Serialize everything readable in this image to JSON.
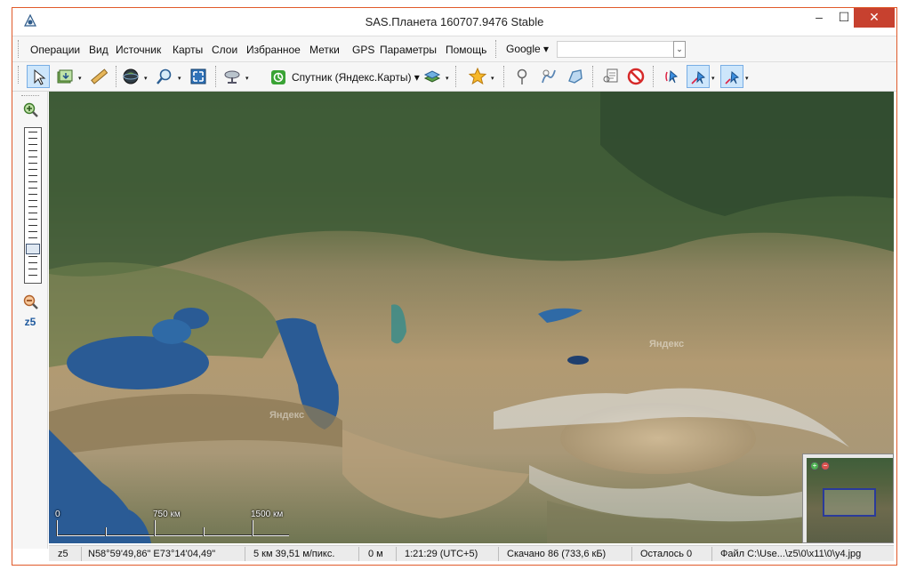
{
  "window": {
    "title": "SAS.Планета 160707.9476 Stable",
    "minimize_glyph": "–",
    "maximize_glyph": "☐",
    "close_glyph": "✕"
  },
  "menu": {
    "items": [
      "Операции",
      "Вид",
      "Источник",
      "Карты",
      "Слои",
      "Избранное",
      "Метки",
      "GPS",
      "Параметры",
      "Помощь"
    ],
    "search_provider": "Google ▾",
    "search_value": "",
    "dropdown_glyph": "⌄"
  },
  "toolbar": {
    "map_type_label": "Спутник (Яндекс.Карты) ▾",
    "arrow_glyph": "▾",
    "icons": [
      "cursor-icon",
      "tile-download-icon",
      "ruler-icon",
      "globe-icon",
      "magnifier-icon",
      "fullscreen-icon",
      "satellite-dish-icon",
      "map-source-icon",
      "layers-icon",
      "favorites-star-icon",
      "placemark-icon",
      "path-icon",
      "polygon-icon",
      "marks-list-icon",
      "no-marks-icon",
      "gps-icon",
      "gps-track-icon",
      "gps-center-icon"
    ]
  },
  "side_panel": {
    "zoom_in_glyph": "+",
    "zoom_out_glyph": "−",
    "zoom_level": "z5"
  },
  "map": {
    "watermark": "Яндекс",
    "scale": {
      "labels": [
        "0",
        "750 км",
        "1500 км"
      ]
    },
    "colors": {
      "land_desert": "#b49a72",
      "forest": "#3e5a33",
      "water": "#2a5b95",
      "snow": "#e8ecf0"
    }
  },
  "statusbar": {
    "zoom": "z5",
    "coordinates": "N58°59'49,86\" E73°14'04,49\"",
    "resolution": "5 км 39,51 м/пикс.",
    "altitude": "0 м",
    "time": "1:21:29 (UTC+5)",
    "downloaded": "Скачано 86 (733,6 кБ)",
    "remaining": "Осталось 0",
    "file": "Файл C:\\Use...\\z5\\0\\x11\\0\\y4.jpg"
  }
}
